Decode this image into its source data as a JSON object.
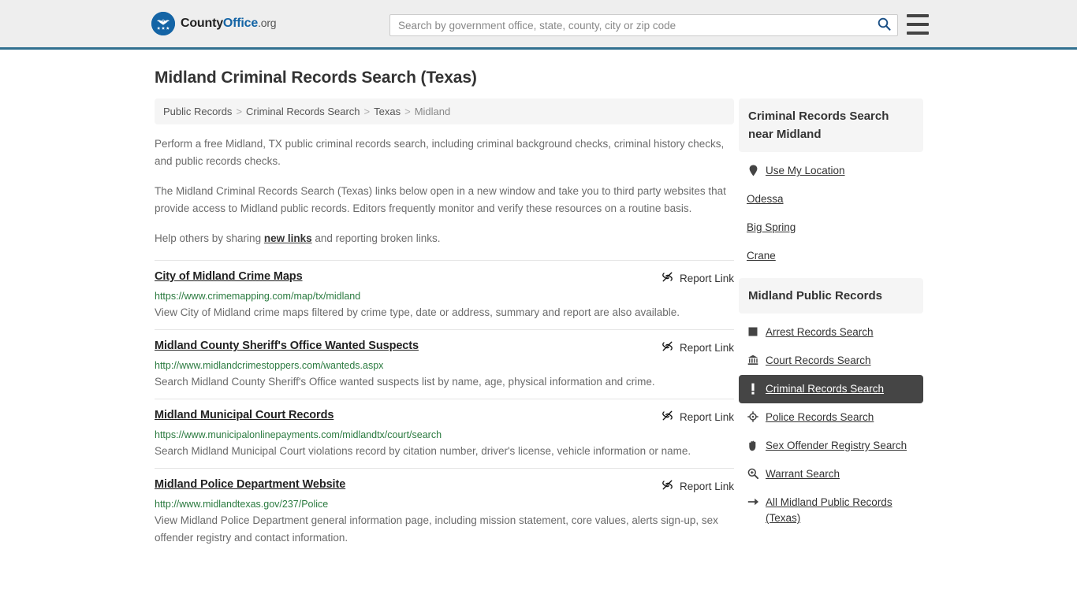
{
  "header": {
    "logo": {
      "text_part1": "County",
      "text_part2": "Office",
      "text_part3": ".org",
      "icon": "eagle-seal-icon"
    },
    "search": {
      "placeholder": "Search by government office, state, county, city or zip code",
      "value": "",
      "icon": "search-icon"
    },
    "menu_icon": "hamburger-menu-icon",
    "accent_color": "#31708f"
  },
  "page": {
    "title": "Midland Criminal Records Search (Texas)"
  },
  "breadcrumb": {
    "items": [
      {
        "label": "Public Records",
        "current": false
      },
      {
        "label": "Criminal Records Search",
        "current": false
      },
      {
        "label": "Texas",
        "current": false
      },
      {
        "label": "Midland",
        "current": true
      }
    ],
    "separator": ">"
  },
  "intro": {
    "p1": "Perform a free Midland, TX public criminal records search, including criminal background checks, criminal history checks, and public records checks.",
    "p2": "The Midland Criminal Records Search (Texas) links below open in a new window and take you to third party websites that provide access to Midland public records. Editors frequently monitor and verify these resources on a routine basis.",
    "p3_before": "Help others by sharing ",
    "p3_link": "new links",
    "p3_after": " and reporting broken links."
  },
  "report_link_label": "Report Link",
  "report_link_icon": "broken-link-icon",
  "results": [
    {
      "title": "City of Midland Crime Maps",
      "url": "https://www.crimemapping.com/map/tx/midland",
      "description": "View City of Midland crime maps filtered by crime type, date or address, summary and report are also available."
    },
    {
      "title": "Midland County Sheriff's Office Wanted Suspects",
      "url": "http://www.midlandcrimestoppers.com/wanteds.aspx",
      "description": "Search Midland County Sheriff's Office wanted suspects list by name, age, physical information and crime."
    },
    {
      "title": "Midland Municipal Court Records",
      "url": "https://www.municipalonlinepayments.com/midlandtx/court/search",
      "description": "Search Midland Municipal Court violations record by citation number, driver's license, vehicle information or name."
    },
    {
      "title": "Midland Police Department Website",
      "url": "http://www.midlandtexas.gov/237/Police",
      "description": "View Midland Police Department general information page, including mission statement, core values, alerts sign-up, sex offender registry and contact information."
    }
  ],
  "sidebar": {
    "nearby": {
      "heading": "Criminal Records Search near Midland",
      "items": [
        {
          "label": "Use My Location",
          "icon": "map-pin-icon",
          "active": false
        },
        {
          "label": "Odessa",
          "icon": "",
          "active": false
        },
        {
          "label": "Big Spring",
          "icon": "",
          "active": false
        },
        {
          "label": "Crane",
          "icon": "",
          "active": false
        }
      ]
    },
    "public_records": {
      "heading": "Midland Public Records",
      "items": [
        {
          "label": "Arrest Records Search",
          "icon": "square-icon",
          "active": false
        },
        {
          "label": "Court Records Search",
          "icon": "courthouse-icon",
          "active": false
        },
        {
          "label": "Criminal Records Search",
          "icon": "exclamation-icon",
          "active": true
        },
        {
          "label": "Police Records Search",
          "icon": "crosshair-icon",
          "active": false
        },
        {
          "label": "Sex Offender Registry Search",
          "icon": "hand-icon",
          "active": false
        },
        {
          "label": "Warrant Search",
          "icon": "magnifier-plus-icon",
          "active": false
        },
        {
          "label": "All Midland Public Records (Texas)",
          "icon": "arrow-right-icon",
          "active": false
        }
      ],
      "active_bg": "#454545"
    }
  }
}
